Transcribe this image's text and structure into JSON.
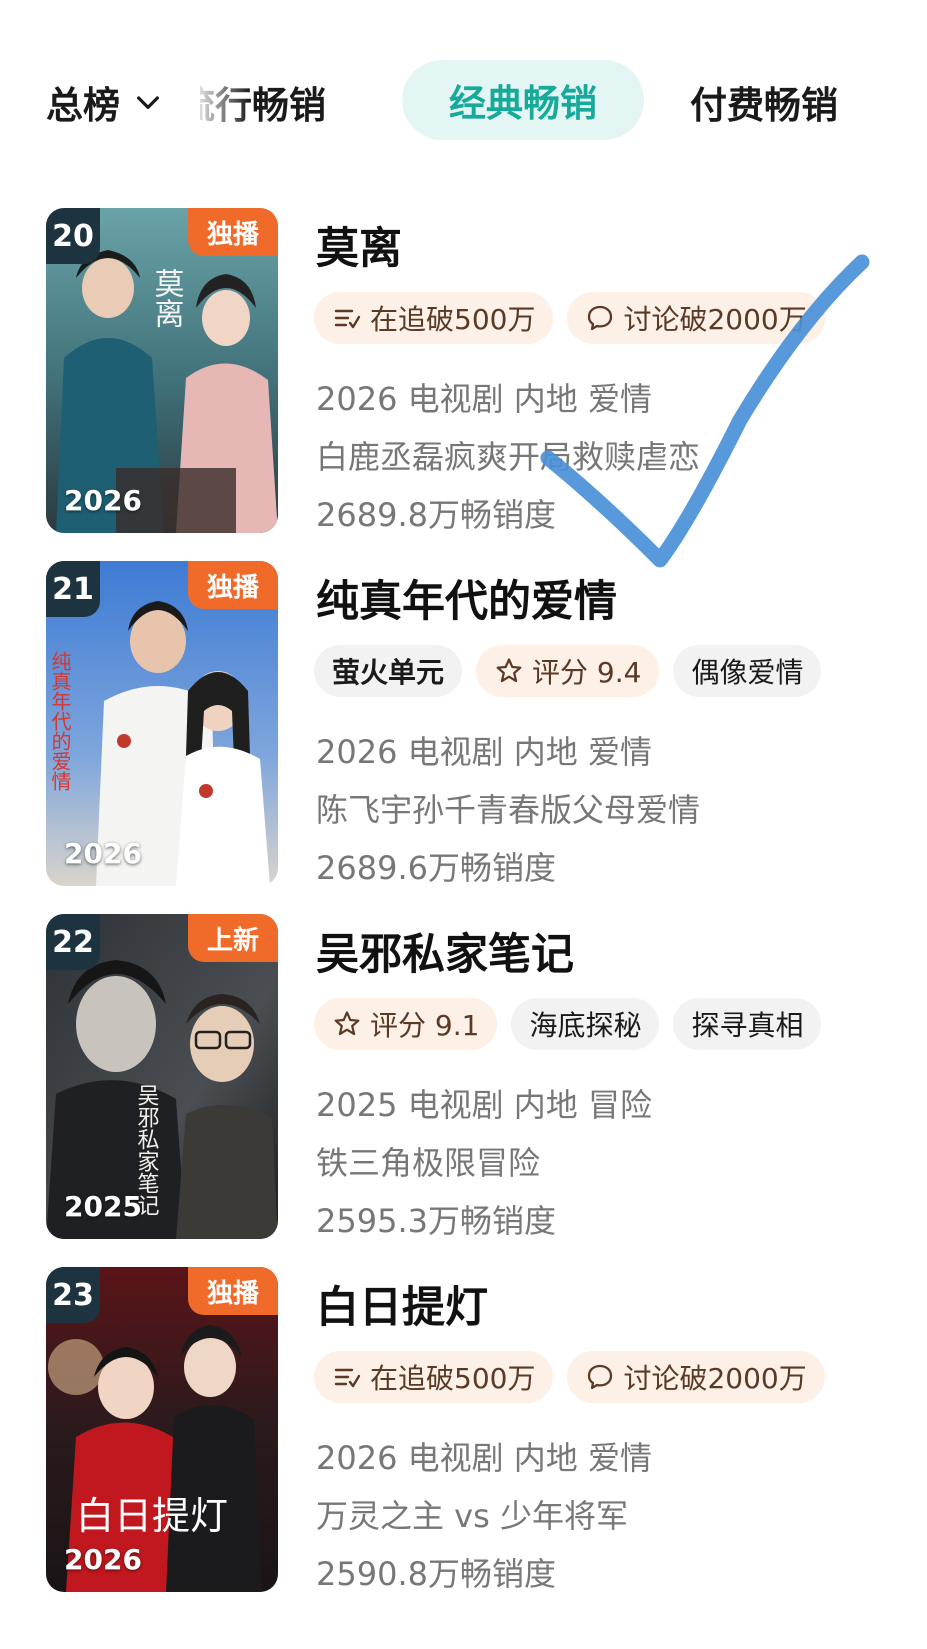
{
  "tabs": {
    "main": "总榜",
    "faded": "流行畅销",
    "active": "经典畅销",
    "last": "付费畅销"
  },
  "items": [
    {
      "rank": "20",
      "badge": "独播",
      "year": "2026",
      "poster_text": "莫离",
      "title": "莫离",
      "tags": [
        {
          "icon": "list-check-icon",
          "label": "在追破500万"
        },
        {
          "icon": "comment-bubble-icon",
          "label": "讨论破2000万"
        }
      ],
      "meta": "2026 电视剧 内地 爱情",
      "desc": "白鹿丞磊疯爽开局救赎虐恋",
      "sales": "2689.8万畅销度"
    },
    {
      "rank": "21",
      "badge": "独播",
      "year": "2026",
      "poster_text": "纯真年代的爱情",
      "title": "纯真年代的爱情",
      "tags": [
        {
          "icon": "",
          "label": "萤火单元"
        },
        {
          "icon": "star-icon",
          "label": "评分 9.4"
        },
        {
          "icon": "",
          "label": "偶像爱情"
        }
      ],
      "meta": "2026 电视剧 内地 爱情",
      "desc": "陈飞宇孙千青春版父母爱情",
      "sales": "2689.6万畅销度"
    },
    {
      "rank": "22",
      "badge": "上新",
      "year": "2025",
      "poster_text": "吴邪私家笔记",
      "title": "吴邪私家笔记",
      "tags": [
        {
          "icon": "star-icon",
          "label": "评分 9.1"
        },
        {
          "icon": "",
          "label": "海底探秘"
        },
        {
          "icon": "",
          "label": "探寻真相"
        }
      ],
      "meta": "2025 电视剧 内地 冒险",
      "desc": "铁三角极限冒险",
      "sales": "2595.3万畅销度"
    },
    {
      "rank": "23",
      "badge": "独播",
      "year": "2026",
      "poster_text": "白日提灯",
      "title": "白日提灯",
      "tags": [
        {
          "icon": "list-check-icon",
          "label": "在追破500万"
        },
        {
          "icon": "comment-bubble-icon",
          "label": "讨论破2000万"
        }
      ],
      "meta": "2026 电视剧 内地 爱情",
      "desc": "万灵之主 vs 少年将军",
      "sales": "2590.8万畅销度"
    }
  ],
  "colors": {
    "accent_teal": "#17a99a",
    "active_tab_bg": "#e3f6f4",
    "badge_orange": "#f06a2a",
    "rank_bg": "#1e3340",
    "warm_tag_bg": "#fdf0e6",
    "checkmark": "#4a90d9"
  }
}
